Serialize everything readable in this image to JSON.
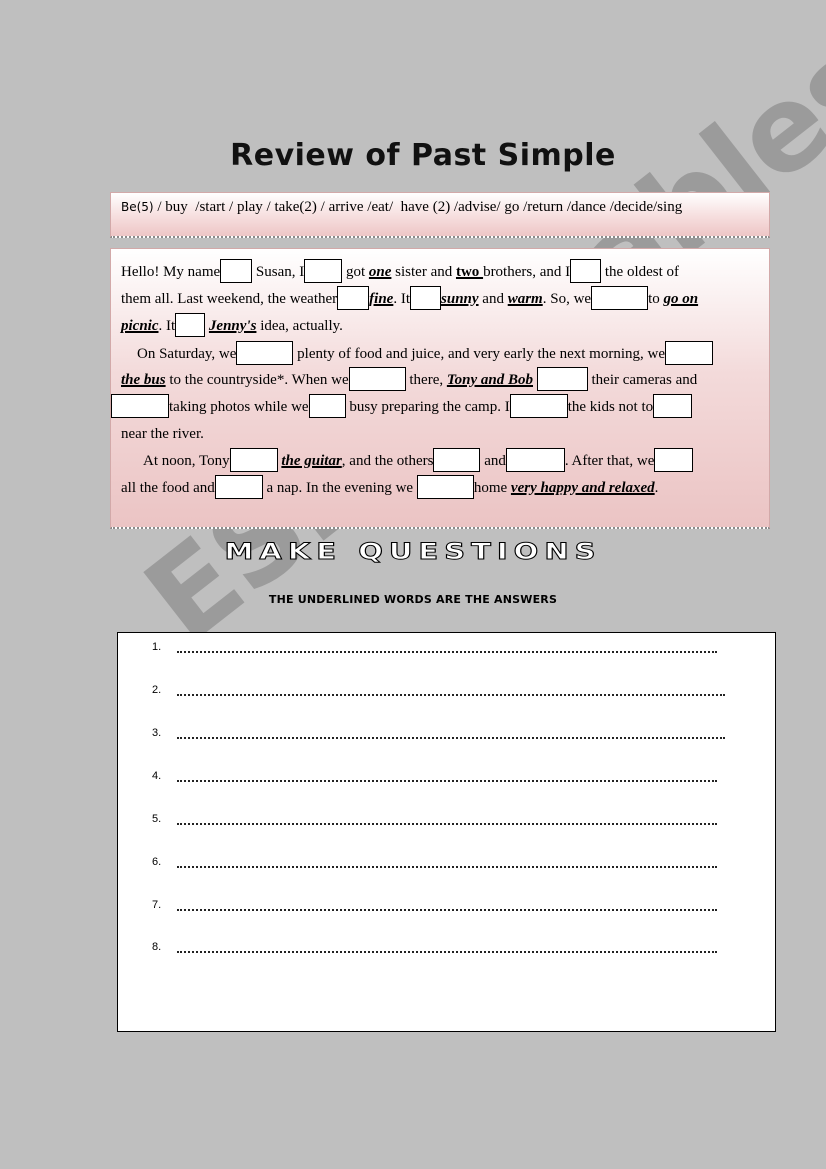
{
  "title": "Review of Past Simple",
  "verbs": {
    "first": "Be(5)",
    "rest": " / buy  /start / play / take(2) / arrive /eat/  have (2) /advise/ go /return /dance /decide/sing"
  },
  "text": {
    "l1": {
      "a": "Hello! My name",
      "b": " Susan, I",
      "c": " got ",
      "d": "one",
      "e": " sister and ",
      "f": "two ",
      "g": "brothers, and I",
      "h": " the oldest of"
    },
    "l2": {
      "a": "them all. Last weekend, the weather",
      "b": "fine",
      "c": ". It",
      "d": "sunny",
      "e": " and ",
      "f": "warm",
      "g": ". So, we",
      "h": "to ",
      "i": "go on"
    },
    "l3": {
      "a": "picnic",
      "b": ". It",
      "c": "Jenny's",
      "d": " idea, actually."
    },
    "l4": {
      "a": "On Saturday, we",
      "b": " plenty of food and juice, and very early the next morning, we"
    },
    "l5": {
      "a": "the bus",
      "b": " to the countryside*. When we",
      "c": " there, ",
      "d": "Tony and Bob",
      "e": " their cameras and"
    },
    "l6": {
      "a": "taking photos while we",
      "b": "  busy preparing the camp. I",
      "c": "the kids not to"
    },
    "l7": {
      "a": "near the river."
    },
    "l8": {
      "a": "At noon, Tony",
      "b": "the guitar",
      "c": ", and the others",
      "d": "and",
      "e": ". After that, we"
    },
    "l9": {
      "a": "all the food and",
      "b": " a nap. In the evening we",
      "c": "home ",
      "d": "very happy and relaxed",
      "e": "."
    }
  },
  "make_questions": "MAKE QUESTIONS",
  "instruction": "THE UNDERLINED WORDS ARE THE ANSWERS",
  "questions": [
    "1.",
    "2.",
    "3.",
    "4.",
    "5.",
    "6.",
    "7.",
    "8."
  ],
  "watermark": "ESLprintables.com"
}
